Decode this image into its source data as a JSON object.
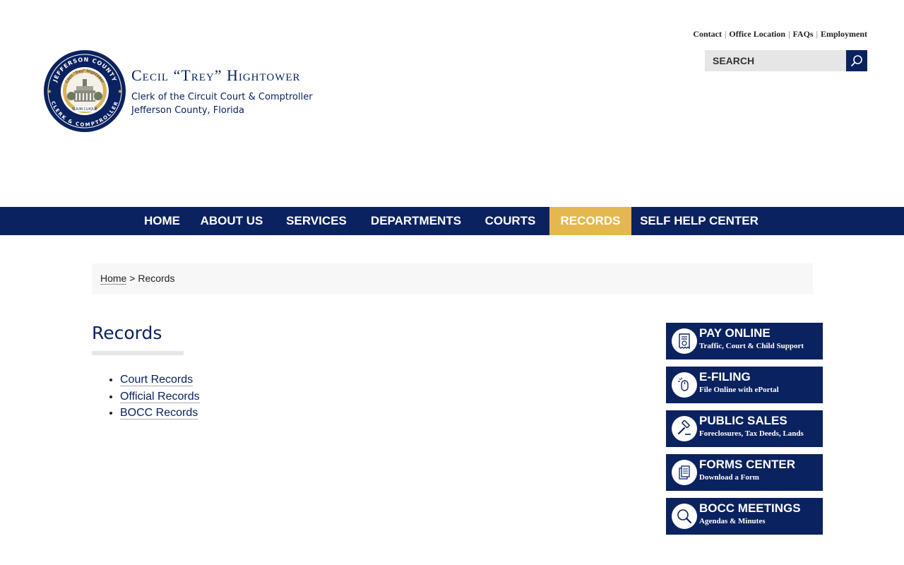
{
  "header": {
    "title": "Cecil “Trey” Hightower",
    "subtitle1": "Clerk of the Circuit Court & Comptroller",
    "subtitle2": "Jefferson County, Florida",
    "seal": {
      "top_text": "JEFFERSON COUNTY",
      "bottom_text": "CLERK & COMPTROLLER",
      "inner_top": "Cecil \"Trey\" Hightower",
      "inner_bottom": "SUUM CUIQUE"
    }
  },
  "top_links": [
    {
      "label": "Contact"
    },
    {
      "label": "Office Location"
    },
    {
      "label": "FAQs"
    },
    {
      "label": "Employment"
    }
  ],
  "search": {
    "placeholder": "SEARCH",
    "icon": "search-icon"
  },
  "nav": {
    "items": [
      {
        "label": "HOME"
      },
      {
        "label": "ABOUT US"
      },
      {
        "label": "SERVICES"
      },
      {
        "label": "DEPARTMENTS"
      },
      {
        "label": "COURTS"
      },
      {
        "label": "RECORDS"
      },
      {
        "label": "SELF HELP CENTER"
      }
    ],
    "active": "RECORDS"
  },
  "breadcrumb": {
    "home": "Home",
    "separator": ">",
    "current": "Records"
  },
  "main": {
    "title": "Records",
    "links": [
      {
        "label": "Court Records"
      },
      {
        "label": "Official Records"
      },
      {
        "label": "BOCC Records"
      }
    ]
  },
  "quick_links": [
    {
      "title": "PAY ONLINE",
      "subtitle": "Traffic, Court & Child Support",
      "icon": "receipt-icon"
    },
    {
      "title": "E-FILING",
      "subtitle": "File Online with ePortal",
      "icon": "mouse-icon"
    },
    {
      "title": "PUBLIC SALES",
      "subtitle": "Foreclosures, Tax Deeds, Lands",
      "icon": "gavel-icon"
    },
    {
      "title": "FORMS CENTER",
      "subtitle": "Download a Form",
      "icon": "documents-icon"
    },
    {
      "title": "BOCC MEETINGS",
      "subtitle": "Agendas & Minutes",
      "icon": "magnifier-icon"
    }
  ],
  "colors": {
    "navy": "#0b2260",
    "gold": "#e4b84f",
    "breadcrumb_bg": "#f7f7f7",
    "search_bg": "#e6e6e6"
  }
}
